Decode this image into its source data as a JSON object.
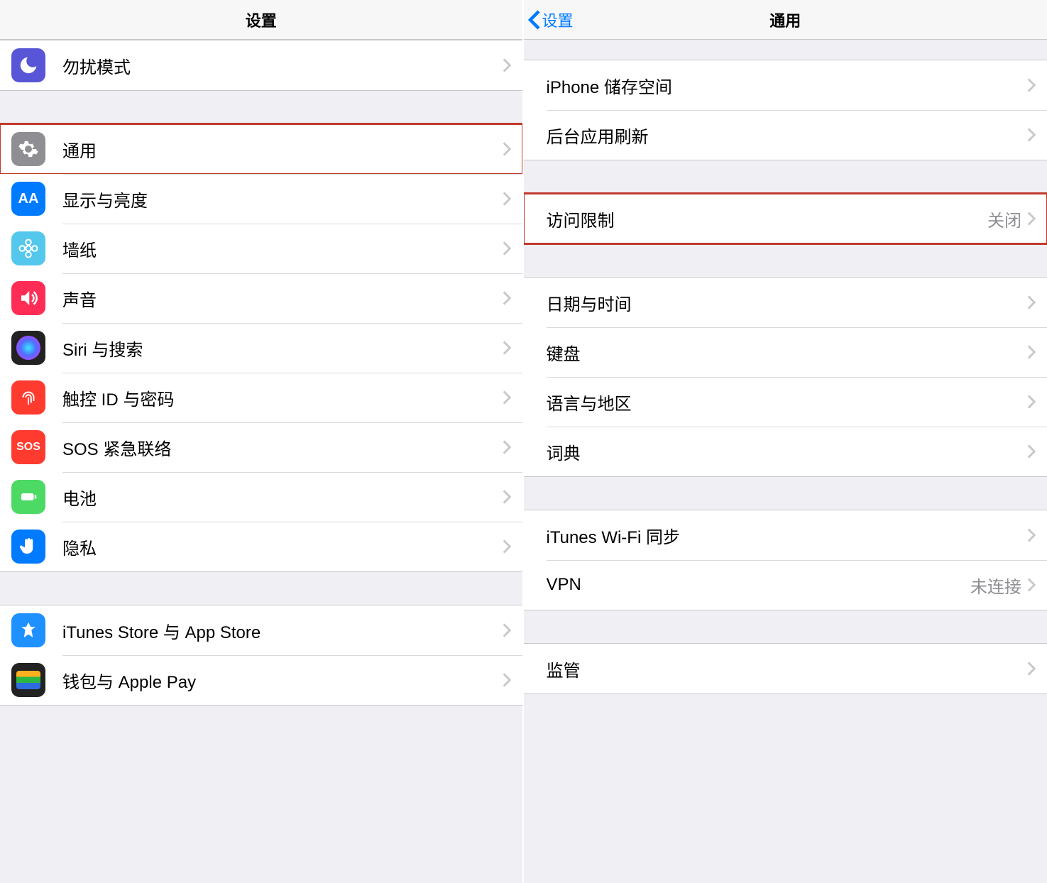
{
  "left": {
    "title": "设置",
    "groups": [
      {
        "rows": [
          {
            "icon": "moon-icon",
            "icon_class": "ic-dnd",
            "label": "勿扰模式"
          }
        ]
      },
      {
        "highlight_first": true,
        "rows": [
          {
            "icon": "gear-icon",
            "icon_class": "ic-general",
            "label": "通用"
          },
          {
            "icon": "display-aa-icon",
            "icon_class": "ic-display",
            "label": "显示与亮度"
          },
          {
            "icon": "flower-icon",
            "icon_class": "ic-wallpaper",
            "label": "墙纸"
          },
          {
            "icon": "speaker-icon",
            "icon_class": "ic-sound",
            "label": "声音"
          },
          {
            "icon": "siri-icon",
            "icon_class": "ic-siri",
            "label": "Siri 与搜索"
          },
          {
            "icon": "fingerprint-icon",
            "icon_class": "ic-touchid",
            "label": "触控 ID 与密码"
          },
          {
            "icon": "sos-icon",
            "icon_class": "ic-sos",
            "label": "SOS 紧急联络",
            "icon_text": "SOS"
          },
          {
            "icon": "battery-icon",
            "icon_class": "ic-battery",
            "label": "电池"
          },
          {
            "icon": "hand-icon",
            "icon_class": "ic-privacy",
            "label": "隐私"
          }
        ]
      },
      {
        "rows": [
          {
            "icon": "appstore-icon",
            "icon_class": "ic-store",
            "label": "iTunes Store 与 App Store"
          },
          {
            "icon": "wallet-icon",
            "icon_class": "ic-wallet",
            "label": "钱包与 Apple Pay"
          }
        ]
      }
    ]
  },
  "right": {
    "back_label": "设置",
    "title": "通用",
    "groups": [
      {
        "rows": [
          {
            "label": "iPhone 储存空间"
          },
          {
            "label": "后台应用刷新"
          }
        ]
      },
      {
        "highlight_first": true,
        "rows": [
          {
            "label": "访问限制",
            "value": "关闭"
          }
        ]
      },
      {
        "rows": [
          {
            "label": "日期与时间"
          },
          {
            "label": "键盘"
          },
          {
            "label": "语言与地区"
          },
          {
            "label": "词典"
          }
        ]
      },
      {
        "rows": [
          {
            "label": "iTunes Wi-Fi 同步"
          },
          {
            "label": "VPN",
            "value": "未连接"
          }
        ]
      },
      {
        "rows": [
          {
            "label": "监管"
          }
        ]
      }
    ]
  }
}
